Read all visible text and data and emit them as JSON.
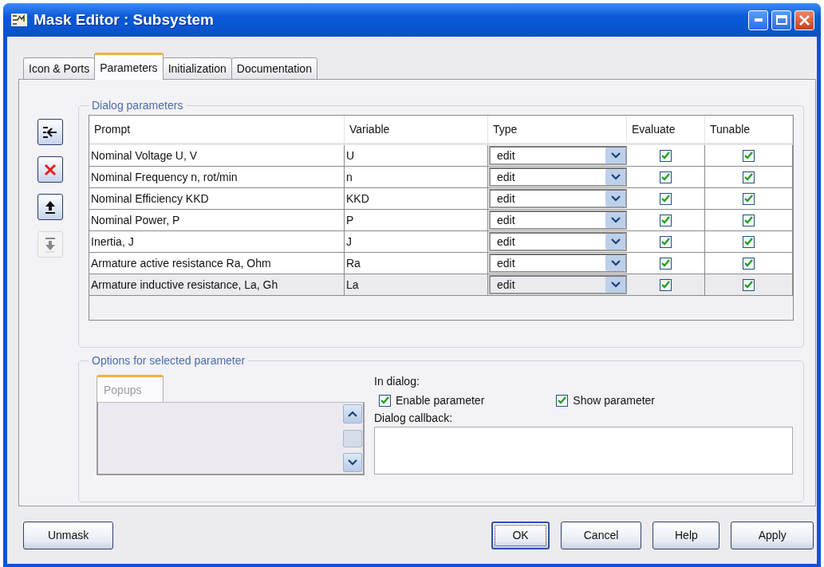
{
  "window": {
    "title": "Mask Editor : Subsystem"
  },
  "tabs": [
    {
      "label": "Icon & Ports",
      "selected": false
    },
    {
      "label": "Parameters",
      "selected": true
    },
    {
      "label": "Initialization",
      "selected": false
    },
    {
      "label": "Documentation",
      "selected": false
    }
  ],
  "dialog_parameters": {
    "title": "Dialog parameters",
    "side_buttons": [
      {
        "kind": "add",
        "disabled": false
      },
      {
        "kind": "delete",
        "disabled": false
      },
      {
        "kind": "up",
        "disabled": false
      },
      {
        "kind": "down",
        "disabled": true
      }
    ],
    "columns": [
      "Prompt",
      "Variable",
      "Type",
      "Evaluate",
      "Tunable"
    ],
    "rows": [
      {
        "prompt": "Nominal Voltage U, V",
        "variable": "U",
        "type": "edit",
        "evaluate": true,
        "tunable": true,
        "selected": false
      },
      {
        "prompt": "Nominal Frequency n, rot/min",
        "variable": "n",
        "type": "edit",
        "evaluate": true,
        "tunable": true,
        "selected": false
      },
      {
        "prompt": "Nominal Efficiency KKD",
        "variable": "KKD",
        "type": "edit",
        "evaluate": true,
        "tunable": true,
        "selected": false
      },
      {
        "prompt": "Nominal Power, P",
        "variable": "P",
        "type": "edit",
        "evaluate": true,
        "tunable": true,
        "selected": false
      },
      {
        "prompt": "Inertia, J",
        "variable": "J",
        "type": "edit",
        "evaluate": true,
        "tunable": true,
        "selected": false
      },
      {
        "prompt": "Armature active resistance Ra, Ohm",
        "variable": "Ra",
        "type": "edit",
        "evaluate": true,
        "tunable": true,
        "selected": false
      },
      {
        "prompt": "Armature inductive resistance, La, Gh",
        "variable": "La",
        "type": "edit",
        "evaluate": true,
        "tunable": true,
        "selected": true
      }
    ]
  },
  "options": {
    "title": "Options for selected parameter",
    "popups_tab": {
      "label": "Popups",
      "disabled": true
    },
    "in_dialog_label": "In dialog:",
    "checkboxes": [
      {
        "label": "Enable parameter",
        "checked": true
      },
      {
        "label": "Show parameter",
        "checked": true
      }
    ],
    "callback_label": "Dialog callback:"
  },
  "buttons": [
    {
      "label": "Unmask",
      "default": false
    },
    {
      "label": "OK",
      "default": true
    },
    {
      "label": "Cancel",
      "default": false
    },
    {
      "label": "Help",
      "default": false
    },
    {
      "label": "Apply",
      "default": false
    }
  ]
}
